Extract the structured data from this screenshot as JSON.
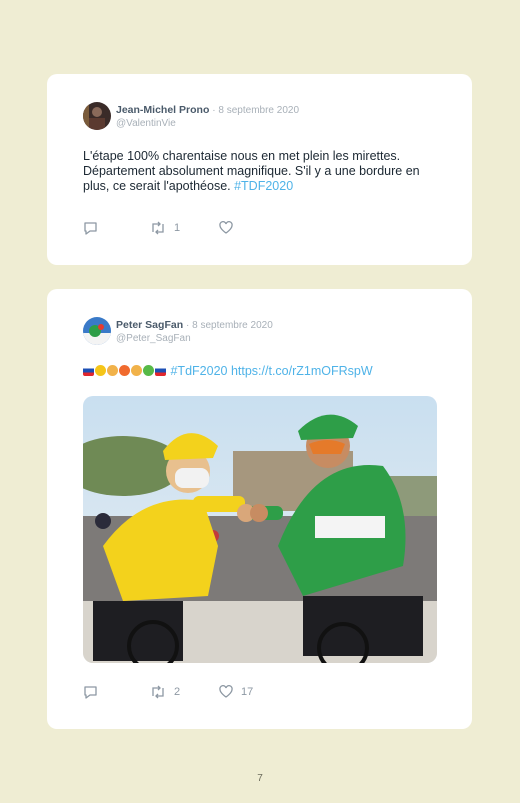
{
  "posts": [
    {
      "author": "Jean-Michel Prono",
      "date": "· 8 septembre 2020",
      "handle": "@ValentinVie",
      "text": "L'étape 100% charentaise nous en met plein les mirettes. Département absolument magnifique. S'il y a une bordure en plus, ce serait l'apothéose. ",
      "hashtag": "#TDF2020",
      "retweets": "1",
      "likes": ""
    },
    {
      "author": "Peter SagFan",
      "date": "· 8 septembre 2020",
      "handle": "@Peter_SagFan",
      "hashtag": "#TdF2020",
      "link": "https://t.co/rZ1mOFRspW",
      "retweets": "2",
      "likes": "17"
    }
  ],
  "page_number": "7",
  "colors": {
    "background": "#efedd3",
    "link": "#4fb3e8",
    "yellow_jersey": "#f3d21c",
    "green_jersey": "#2e9e48"
  }
}
